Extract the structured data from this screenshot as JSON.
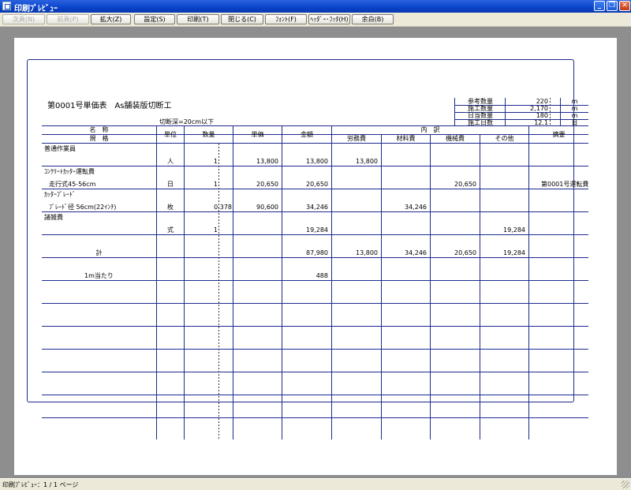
{
  "window": {
    "title": "印刷ﾌﾟﾚﾋﾞｭｰ"
  },
  "toolbar": {
    "buttons": [
      {
        "label": "次頁(N)"
      },
      {
        "label": "前頁(P)"
      },
      {
        "label": "拡大(Z)"
      },
      {
        "label": "設定(S)"
      },
      {
        "label": "印刷(T)"
      },
      {
        "label": "閉じる(C)"
      },
      {
        "label": "ﾌｫﾝﾄ(F)"
      },
      {
        "label": "ﾍｯﾀﾞｰ･ﾌｯﾀ(H)"
      },
      {
        "label": "余白(B)"
      }
    ]
  },
  "report": {
    "title": "第0001号単価表　As舗装版切断工",
    "condition": "切断深=20cm以下",
    "summary": [
      {
        "label": "参考数量",
        "value": "220",
        "unit": "m"
      },
      {
        "label": "施工数量",
        "value": "2,170",
        "unit": "m"
      },
      {
        "label": "日当数量",
        "value": "180",
        "unit": "m"
      },
      {
        "label": "施工日数",
        "value": "12.1",
        "unit": "日"
      }
    ],
    "headers": {
      "name": "名　称",
      "spec": "規　格",
      "unit": "単位",
      "qty": "数量",
      "price": "単価",
      "amount": "金額",
      "breakdown": "内　訳",
      "labor": "労務費",
      "material": "材料費",
      "machine": "機械費",
      "other": "その他",
      "remarks": "摘要"
    },
    "rows": [
      {
        "name": "普通作業員",
        "spec": "",
        "unit": "人",
        "qty": "1",
        "price": "13,800",
        "amount": "13,800",
        "labor": "13,800",
        "material": "",
        "machine": "",
        "other": "",
        "remarks": ""
      },
      {
        "name": "ｺﾝｸﾘｰﾄｶｯﾀｰ運転費",
        "spec": "走行式45-56cm",
        "unit": "日",
        "qty": "1",
        "price": "20,650",
        "amount": "20,650",
        "labor": "",
        "material": "",
        "machine": "20,650",
        "other": "",
        "remarks": "第0001号運転費"
      },
      {
        "name": "ｶｯﾀｰﾌﾞﾚｰﾄﾞ",
        "spec": "ﾌﾞﾚｰﾄﾞ径 56cm(22ｲﾝﾁ)",
        "unit": "枚",
        "qty": "0.378",
        "price": "90,600",
        "amount": "34,246",
        "labor": "",
        "material": "34,246",
        "machine": "",
        "other": "",
        "remarks": ""
      },
      {
        "name": "諸雑費",
        "spec": "",
        "unit": "式",
        "qty": "1",
        "price": "",
        "amount": "19,284",
        "labor": "",
        "material": "",
        "machine": "",
        "other": "19,284",
        "remarks": ""
      },
      {
        "name": "",
        "spec": "計",
        "unit": "",
        "qty": "",
        "price": "",
        "amount": "87,980",
        "labor": "13,800",
        "material": "34,246",
        "machine": "20,650",
        "other": "19,284",
        "remarks": ""
      },
      {
        "name": "",
        "spec": "1m当たり",
        "unit": "",
        "qty": "",
        "price": "",
        "amount": "488",
        "labor": "",
        "material": "",
        "machine": "",
        "other": "",
        "remarks": ""
      },
      {},
      {},
      {},
      {},
      {},
      {},
      {}
    ]
  },
  "status": {
    "text": "印刷ﾌﾟﾚﾋﾞｭｰ：1 / 1 ページ"
  }
}
